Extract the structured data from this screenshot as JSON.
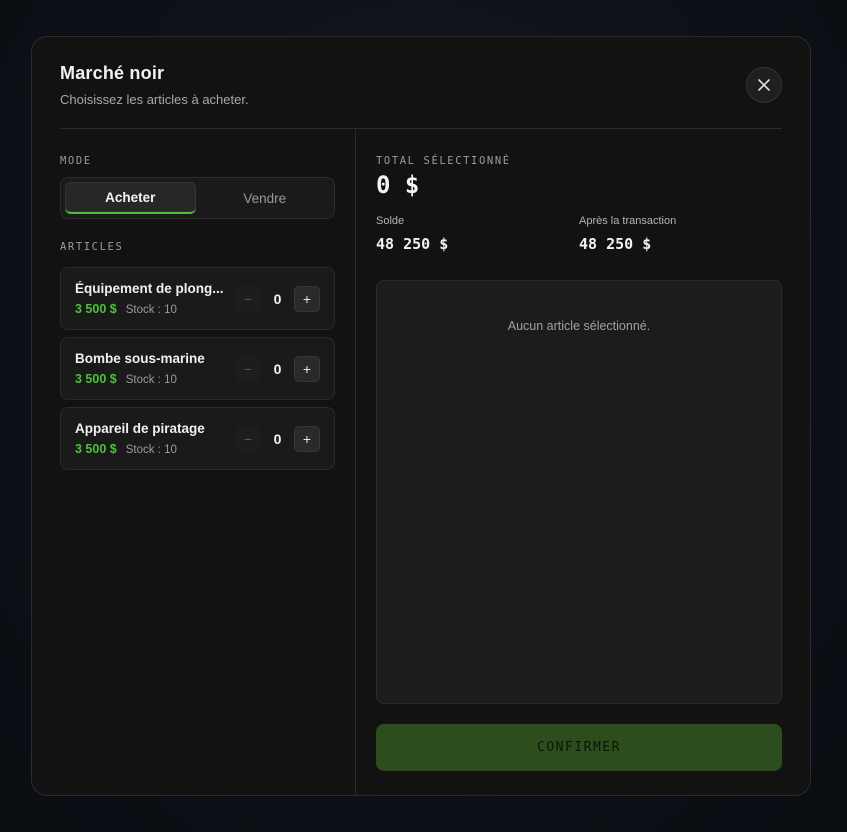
{
  "header": {
    "title": "Marché noir",
    "subtitle": "Choisissez les articles à acheter."
  },
  "icons": {
    "close": "close-icon"
  },
  "mode": {
    "label": "MODE",
    "options": [
      {
        "label": "Acheter",
        "active": true
      },
      {
        "label": "Vendre",
        "active": false
      }
    ]
  },
  "articles": {
    "label": "ARTICLES",
    "items": [
      {
        "name": "Équipement de plong...",
        "price": "3 500 $",
        "stock": "Stock : 10",
        "quantity": "0"
      },
      {
        "name": "Bombe sous-marine",
        "price": "3 500 $",
        "stock": "Stock : 10",
        "quantity": "0"
      },
      {
        "name": "Appareil de piratage",
        "price": "3 500 $",
        "stock": "Stock : 10",
        "quantity": "0"
      }
    ],
    "minus_symbol": "−",
    "plus_symbol": "+"
  },
  "summary": {
    "total_label": "TOTAL SÉLECTIONNÉ",
    "total_value": "0 $",
    "balance_label": "Solde",
    "balance_value": "48 250 $",
    "after_label": "Après la transaction",
    "after_value": "48 250 $",
    "empty_text": "Aucun article sélectionné.",
    "confirm_label": "CONFIRMER"
  },
  "colors": {
    "accent_green": "#4cc13a",
    "confirm_bg": "#2c4d1c",
    "panel_bg": "#121212"
  }
}
